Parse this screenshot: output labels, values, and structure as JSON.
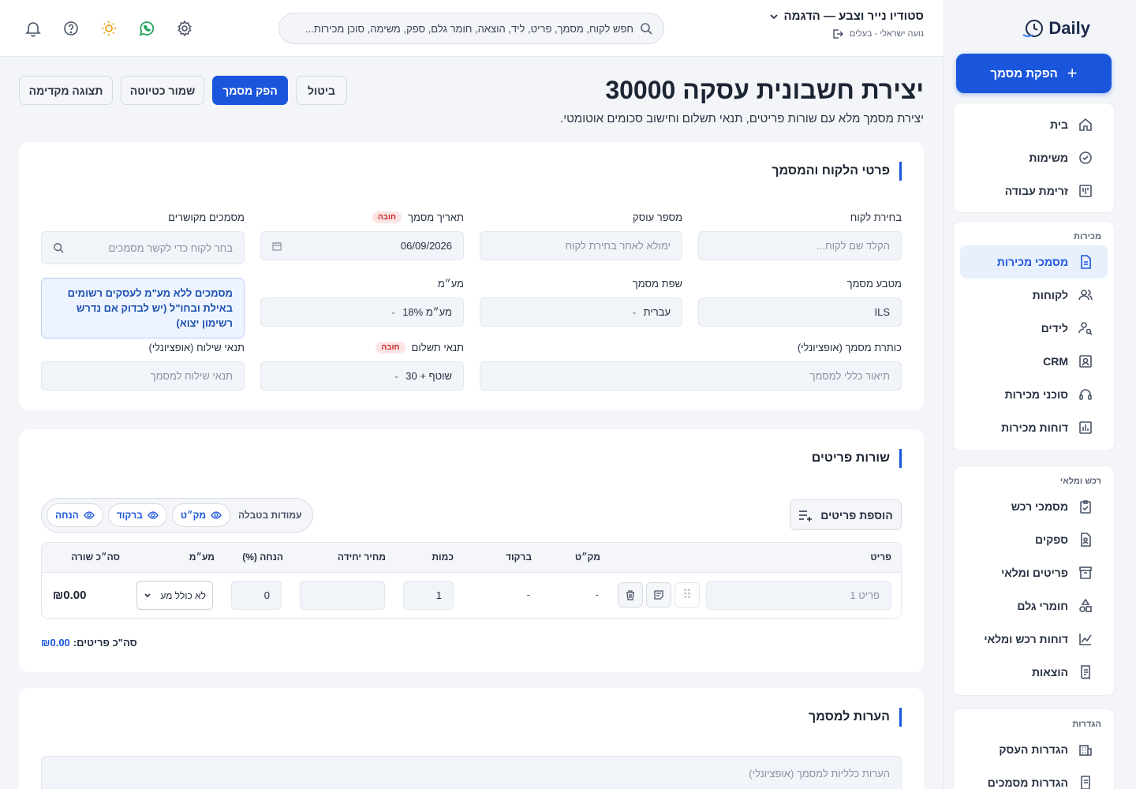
{
  "app": {
    "name": "Daily"
  },
  "sidebar": {
    "cta_label": "הפקת מסמך",
    "groups": [
      {
        "title": "",
        "items": [
          {
            "label": "בית",
            "icon": "home-icon"
          },
          {
            "label": "משימות",
            "icon": "check-circle-icon"
          },
          {
            "label": "זרימת עבודה",
            "icon": "kanban-icon"
          }
        ]
      },
      {
        "title": "מכירות",
        "items": [
          {
            "label": "מסמכי מכירות",
            "icon": "document-icon",
            "active": true
          },
          {
            "label": "לקוחות",
            "icon": "users-icon"
          },
          {
            "label": "לידים",
            "icon": "user-search-icon"
          },
          {
            "label": "CRM",
            "icon": "contact-card-icon"
          },
          {
            "label": "סוכני מכירות",
            "icon": "headset-icon"
          },
          {
            "label": "דוחות מכירות",
            "icon": "bar-chart-icon"
          }
        ]
      },
      {
        "title": "רכש ומלאי",
        "items": [
          {
            "label": "מסמכי רכש",
            "icon": "clipboard-check-icon"
          },
          {
            "label": "ספקים",
            "icon": "file-user-icon"
          },
          {
            "label": "פריטים ומלאי",
            "icon": "archive-icon"
          },
          {
            "label": "חומרי גלם",
            "icon": "shapes-icon"
          },
          {
            "label": "דוחות רכש ומלאי",
            "icon": "line-chart-icon"
          },
          {
            "label": "הוצאות",
            "icon": "receipt-icon"
          }
        ]
      },
      {
        "title": "הגדרות",
        "items": [
          {
            "label": "הגדרות העסק",
            "icon": "building-icon"
          },
          {
            "label": "הגדרות מסמכים",
            "icon": "doc-settings-icon"
          }
        ]
      }
    ]
  },
  "topbar": {
    "business_name": "סטודיו נייר וצבע — הדגמה",
    "user_line": "נועה ישראלי - בעלים",
    "search_placeholder": "חפש לקוח, מסמך, פריט, ליד, הוצאה, חומר גלם, ספק, משימה, סוכן מכירות...",
    "icons": [
      "bell-icon",
      "help-icon",
      "sun-icon",
      "whatsapp-icon",
      "settings-icon"
    ],
    "accent": "#1a56db"
  },
  "page": {
    "title": "יצירת חשבונית עסקה 30000",
    "subtitle": "יצירת מסמך מלא עם שורות פריטים, תנאי תשלום וחישוב סכומים אוטומטי.",
    "buttons": {
      "cancel": "ביטול",
      "issue": "הפק מסמך",
      "draft": "שמור כטיוטה",
      "preview": "תצוגה מקדימה"
    }
  },
  "details": {
    "title": "פרטי הלקוח והמסמך",
    "required_badge": "חובה",
    "client": {
      "label": "בחירת לקוח",
      "placeholder": "הקלד שם לקוח..."
    },
    "dealer": {
      "label": "מספר עוסק",
      "placeholder": "ימולא לאחר בחירת לקוח"
    },
    "date": {
      "label": "תאריך מסמך",
      "value": "06/09/2026"
    },
    "related": {
      "label": "מסמכים מקושרים",
      "placeholder": "בחר לקוח כדי לקשר מסמכים"
    },
    "currency": {
      "label": "מטבע מסמך",
      "value": "ILS"
    },
    "language": {
      "label": "שפת מסמך",
      "value": "עברית"
    },
    "vat": {
      "label": "מע״מ",
      "value": "מע״מ 18%"
    },
    "vat_note": "מסמכים ללא מע\"מ לעסקים רשומים באילת ובחו\"ל (יש לבדוק אם נדרש רשימון יצוא)",
    "doc_title": {
      "label": "כותרת מסמך (אופציונלי)",
      "placeholder": "תיאור כללי למסמך"
    },
    "payment_terms": {
      "label": "תנאי תשלום",
      "value": "שוטף + 30"
    },
    "shipping_terms": {
      "label": "תנאי שילוח (אופציונלי)",
      "placeholder": "תנאי שילוח למסמך"
    }
  },
  "items": {
    "title": "שורות פריטים",
    "add_label": "הוספת פריטים",
    "columns_label": "עמודות בטבלה",
    "column_toggles": [
      "מק״ט",
      "ברקוד",
      "הנחה"
    ],
    "headers": [
      "פריט",
      "מק״ט",
      "ברקוד",
      "כמות",
      "מחיר יחידה",
      "הנחה (%)",
      "מע״מ",
      "סה״כ שורה"
    ],
    "row": {
      "item_placeholder": "פריט 1",
      "sku": "-",
      "barcode": "-",
      "qty": "1",
      "unit_price": "",
      "discount": "0",
      "vat": "לא כולל מע",
      "line_total": "₪0.00"
    },
    "total_label": "סה\"כ פריטים:",
    "total_value": "₪0.00"
  },
  "notes": {
    "title": "הערות למסמך",
    "placeholder": "הערות כלליות למסמך (אופציונלי)"
  }
}
